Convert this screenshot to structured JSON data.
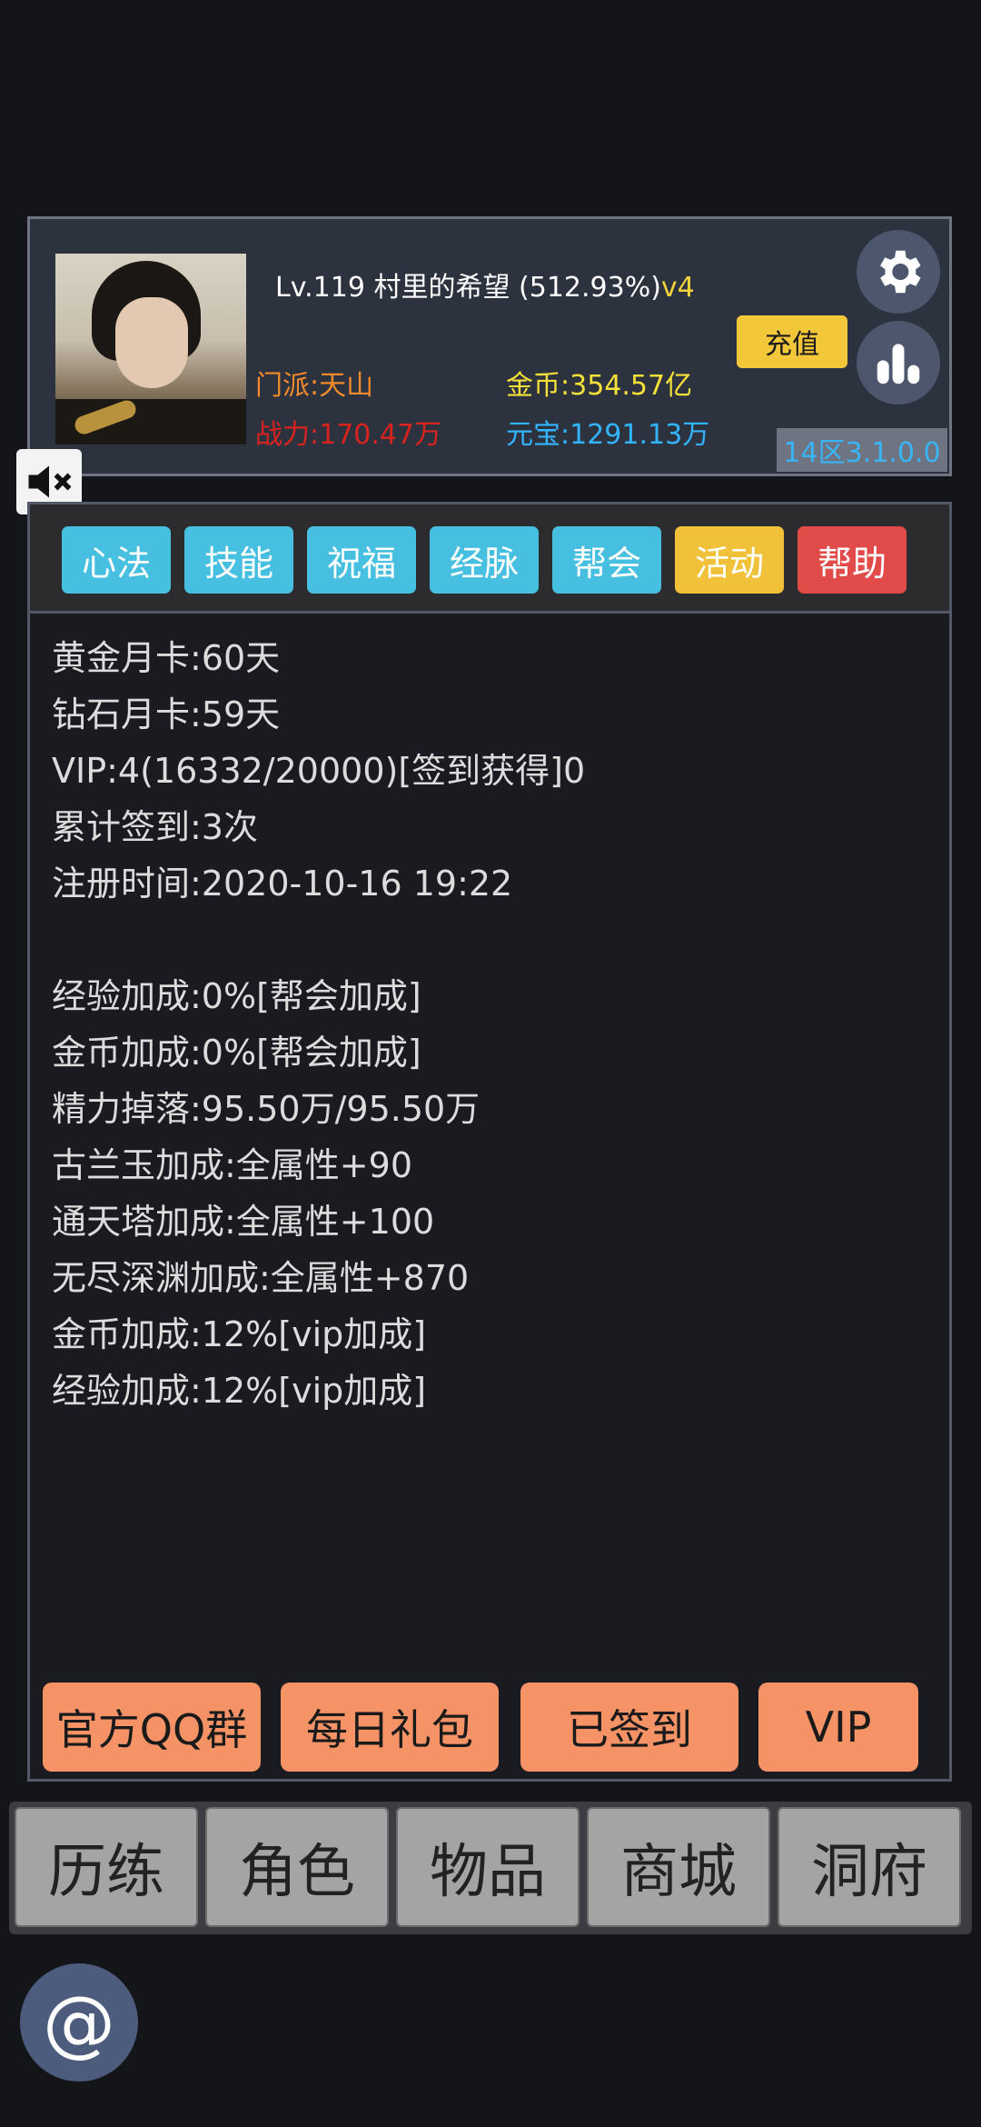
{
  "profile": {
    "level_name": "Lv.119 村里的希望",
    "progress": "(512.93%)",
    "vip_level": "v4",
    "sect": "门派:天山",
    "power": "战力:170.47万",
    "gold": "金币:354.57亿",
    "ingot": "元宝:1291.13万",
    "recharge_label": "充值",
    "server": "14区3.1.0.0"
  },
  "tabs": [
    {
      "label": "心法",
      "color": "#47bfe0"
    },
    {
      "label": "技能",
      "color": "#47bfe0"
    },
    {
      "label": "祝福",
      "color": "#47bfe0"
    },
    {
      "label": "经脉",
      "color": "#47bfe0"
    },
    {
      "label": "帮会",
      "color": "#47bfe0"
    },
    {
      "label": "活动",
      "color": "#f1c13a"
    },
    {
      "label": "帮助",
      "color": "#e14b49"
    }
  ],
  "info_lines": [
    "黄金月卡:60天",
    "钻石月卡:59天",
    "VIP:4(16332/20000)[签到获得]0",
    "累计签到:3次",
    "注册时间:2020-10-16 19:22",
    "经验加成:0%[帮会加成]",
    "金币加成:0%[帮会加成]",
    "精力掉落:95.50万/95.50万",
    "古兰玉加成:全属性+90",
    "通天塔加成:全属性+100",
    "无尽深渊加成:全属性+870",
    "金币加成:12%[vip加成]",
    "经验加成:12%[vip加成]"
  ],
  "actions": {
    "qq_group": "官方QQ群",
    "daily_gift": "每日礼包",
    "signed_in": "已签到",
    "vip": "VIP"
  },
  "bottom_nav": [
    "历练",
    "角色",
    "物品",
    "商城",
    "洞府"
  ],
  "icons": {
    "settings": "gear-icon",
    "stats": "bar-chart-icon",
    "mute": "speaker-muted-icon",
    "contact": "at-icon"
  }
}
